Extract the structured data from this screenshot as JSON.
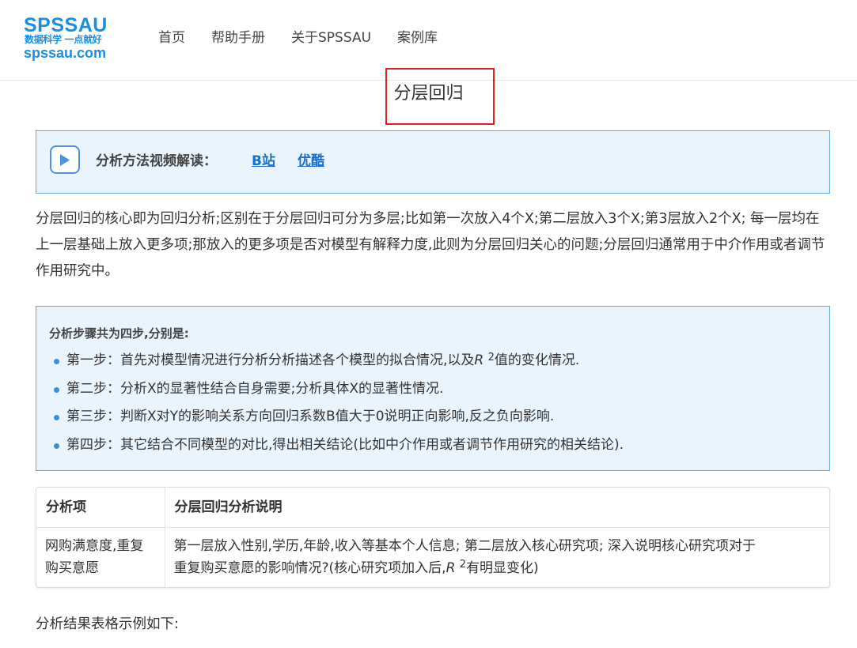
{
  "logo": {
    "main": "SPSSAU",
    "tagline": "数据科学 一点就好",
    "url": "spssau.com"
  },
  "nav": {
    "items": [
      {
        "label": "首页"
      },
      {
        "label": "帮助手册"
      },
      {
        "label": "关于SPSSAU"
      },
      {
        "label": "案例库"
      }
    ]
  },
  "page": {
    "title": "分层回归"
  },
  "video": {
    "label": "分析方法视频解读：",
    "links": [
      {
        "label": "B站"
      },
      {
        "label": "优酷"
      }
    ]
  },
  "intro": "分层回归的核心即为回归分析;区别在于分层回归可分为多层;比如第一次放入4个X;第二层放入3个X;第3层放入2个X; 每一层均在上一层基础上放入更多项;那放入的更多项是否对模型有解释力度,此则为分层回归关心的问题;分层回归通常用于中介作用或者调节作用研究中。",
  "steps": {
    "heading": "分析步骤共为四步,分别是:",
    "items": [
      {
        "pre": "第一步：首先对模型情况进行分析分析描述各个模型的拟合情况,以及",
        "r": "R",
        "sup": "2",
        "post": "值的变化情况."
      },
      {
        "text": "第二步：分析X的显著性结合自身需要;分析具体X的显著性情况."
      },
      {
        "text": "第三步：判断X对Y的影响关系方向回归系数B值大于0说明正向影响,反之负向影响."
      },
      {
        "text": "第四步：其它结合不同模型的对比,得出相关结论(比如中介作用或者调节作用研究的相关结论)."
      }
    ]
  },
  "table": {
    "headers": [
      "分析项",
      "分层回归分析说明"
    ],
    "row": {
      "item_line1": "网购满意度,重复",
      "item_line2": "购买意愿",
      "desc_line1": "第一层放入性别,学历,年龄,收入等基本个人信息; 第二层放入核心研究项; 深入说明核心研究项对于",
      "desc_line2_pre": "重复购买意愿的影响情况?(核心研究项加入后,",
      "desc_r": "R",
      "desc_sup": "2",
      "desc_line2_post": "有明显变化)"
    }
  },
  "footer_text": "分析结果表格示例如下:"
}
